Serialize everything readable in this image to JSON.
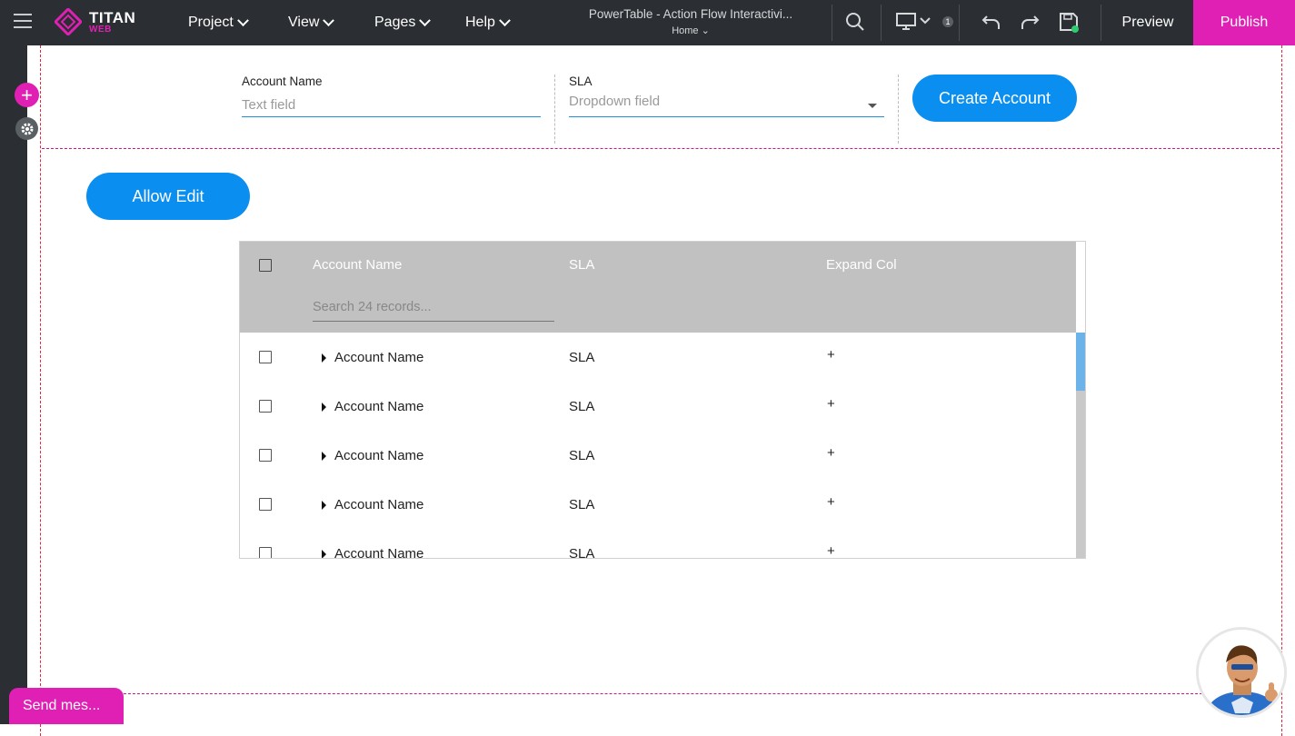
{
  "topbar": {
    "logo_title": "TITAN",
    "logo_sub": "WEB",
    "menu": [
      "Project",
      "View",
      "Pages",
      "Help"
    ],
    "doc_title": "PowerTable - Action Flow Interactivi...",
    "doc_page": "Home",
    "badge_count": "1",
    "preview_label": "Preview",
    "publish_label": "Publish",
    "accent_color": "#e020b4"
  },
  "form": {
    "account_name_label": "Account Name",
    "account_name_placeholder": "Text field",
    "sla_label": "SLA",
    "sla_placeholder": "Dropdown field",
    "create_button": "Create Account"
  },
  "allow_edit_button": "Allow Edit",
  "table": {
    "columns": [
      "Account Name",
      "SLA",
      "Expand Col"
    ],
    "search_placeholder": "Search 24 records...",
    "rows": [
      {
        "account": "Account Name",
        "sla": "SLA",
        "expand": "+"
      },
      {
        "account": "Account Name",
        "sla": "SLA",
        "expand": "+"
      },
      {
        "account": "Account Name",
        "sla": "SLA",
        "expand": "+"
      },
      {
        "account": "Account Name",
        "sla": "SLA",
        "expand": "+"
      },
      {
        "account": "Account Name",
        "sla": "SLA",
        "expand": "+"
      }
    ]
  },
  "send_message_label": "Send mes..."
}
